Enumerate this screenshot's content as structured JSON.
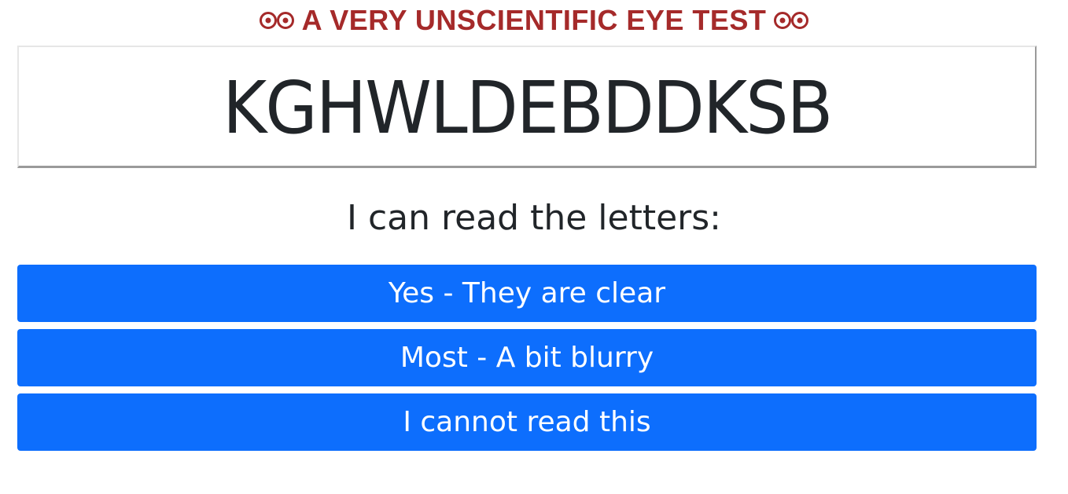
{
  "header": {
    "title": "A VERY UNSCIENTIFIC EYE TEST",
    "icon": "eyes-icon",
    "accent_color": "#a52a2a"
  },
  "test": {
    "letters": "KGHWLDEBDDKSB"
  },
  "prompt": {
    "text": "I can read the letters:"
  },
  "answers": {
    "yes_label": "Yes - They are clear",
    "most_label": "Most - A bit blurry",
    "no_label": "I cannot read this",
    "button_color": "#0d6efd"
  }
}
